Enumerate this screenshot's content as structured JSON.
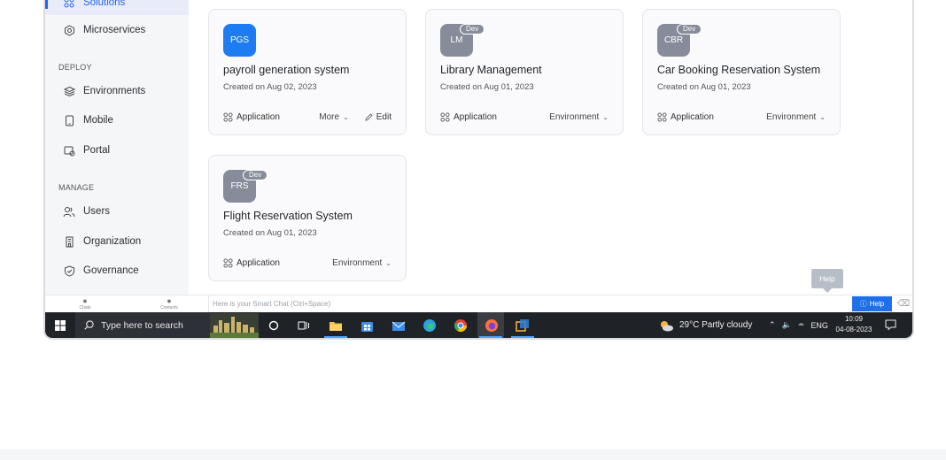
{
  "sidebar": {
    "items_top": [
      {
        "label": "Solutions",
        "icon": "grid-icon",
        "active": true
      },
      {
        "label": "Microservices",
        "icon": "microservices-icon"
      }
    ],
    "deploy_label": "DEPLOY",
    "deploy_items": [
      {
        "label": "Environments",
        "icon": "layers-icon"
      },
      {
        "label": "Mobile",
        "icon": "mobile-icon"
      },
      {
        "label": "Portal",
        "icon": "portal-icon"
      }
    ],
    "manage_label": "MANAGE",
    "manage_items": [
      {
        "label": "Users",
        "icon": "users-icon"
      },
      {
        "label": "Organization",
        "icon": "building-icon"
      },
      {
        "label": "Governance",
        "icon": "shield-icon"
      }
    ]
  },
  "cards": [
    {
      "initials": "PGS",
      "title": "payroll generation system",
      "date": "Created on Aug 02, 2023",
      "type": "Application",
      "action": "More",
      "edit": "Edit",
      "badge": "",
      "color": "#1e7cf2"
    },
    {
      "initials": "LM",
      "title": "Library Management",
      "date": "Created on Aug 01, 2023",
      "type": "Application",
      "action": "Environment",
      "badge": "Dev",
      "color": "#868c99"
    },
    {
      "initials": "CBR",
      "title": "Car Booking Reservation System",
      "date": "Created on Aug 01, 2023",
      "type": "Application",
      "action": "Environment",
      "badge": "Dev",
      "color": "#868c99"
    },
    {
      "initials": "FRS",
      "title": "Flight Reservation System",
      "date": "Created on Aug 01, 2023",
      "type": "Application",
      "action": "Environment",
      "badge": "Dev",
      "color": "#868c99"
    }
  ],
  "chat": {
    "chats_label": "Chats",
    "contacts_label": "Contacts",
    "placeholder": "Here is your Smart Chat (Ctrl+Space)",
    "help_button": "Help",
    "help_tooltip": "Help"
  },
  "taskbar": {
    "search_placeholder": "Type here to search",
    "weather": "29°C  Partly cloudy",
    "lang": "ENG",
    "time": "10:09",
    "date": "04-08-2023"
  }
}
